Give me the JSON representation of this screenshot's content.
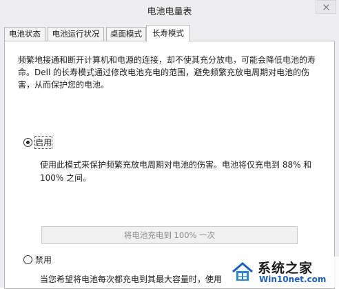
{
  "window": {
    "title": "电池电量表"
  },
  "tabs": [
    {
      "label": "电池状态"
    },
    {
      "label": "电池运行状况"
    },
    {
      "label": "桌面模式"
    },
    {
      "label": "长寿模式"
    }
  ],
  "active_tab": "长寿模式",
  "panel": {
    "description": "频繁地接通和断开计算机和电源的连接，却不使其充分放电，可能会降低电池的寿命。Dell 的长寿模式通过修改电池充电的范围，避免频繁充放电周期对电池的伤害，从而保护您的电池。",
    "enable_option": {
      "label": "启用",
      "selected": true,
      "detail": "使用此模式来保护频繁充放电周期对电池的伤害。电池将仅充电到 88% 和 100% 之间。"
    },
    "charge_button_label": "将电池充电到 100% 一次",
    "disable_option": {
      "label": "禁用",
      "selected": false,
      "detail": "当您希望将电池每次都充电到其最大容量时，使用"
    }
  },
  "watermark": {
    "name": "系统之家",
    "url": "Win10net.com"
  }
}
